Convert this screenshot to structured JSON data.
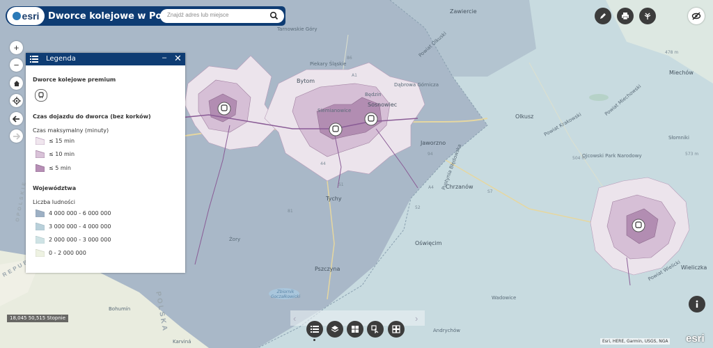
{
  "header": {
    "logo_text": "esri",
    "title": "Dworce kolejowe w Polsce",
    "search_placeholder": "Znajdź adres lub miejsce"
  },
  "toolbar": {
    "icons": [
      "pencil-icon",
      "print-icon",
      "basemap-icon",
      "hide-icon"
    ]
  },
  "map_tools": [
    "zoom-in",
    "zoom-out",
    "home",
    "locate",
    "back",
    "forward"
  ],
  "legend": {
    "title": "Legenda",
    "section_stations": "Dworce kolejowe premium",
    "section_travel": "Czas dojazdu do dworca (bez korków)",
    "travel_subtitle": "Czas maksymalny (minuty)",
    "travel_classes": [
      {
        "label": "≤ 15 min",
        "color": "#f0e6ee"
      },
      {
        "label": "≤ 10 min",
        "color": "#d9c2d8"
      },
      {
        "label": "≤ 5 min",
        "color": "#b78fb6"
      }
    ],
    "section_voivodeships": "Województwa",
    "population_subtitle": "Liczba ludności",
    "population_classes": [
      {
        "label": "4 000 000 - 6 000 000",
        "color": "#9db0c4"
      },
      {
        "label": "3 000 000 - 4 000 000",
        "color": "#b9d0da"
      },
      {
        "label": "2 000 000 - 3 000 000",
        "color": "#cfe3e5"
      },
      {
        "label": "0 - 2 000 000",
        "color": "#eef2e2"
      }
    ]
  },
  "places": [
    "Zawiercie",
    "Tarnowskie Góry",
    "Piekary Śląskie",
    "Bytom",
    "Siemianowice",
    "Sosnowiec",
    "Będzin",
    "Dąbrowa Górnicza",
    "Jaworzno",
    "Chrzanów",
    "Olkusz",
    "Tychy",
    "Żory",
    "Pszczyna",
    "Oświęcim",
    "Wadowice",
    "Andrychów",
    "Bohumín",
    "Karviná",
    "Wieliczka",
    "Miechów",
    "Słomniki",
    "Zbiornik Goczałkowicki",
    "Pustynia Błędowska",
    "Ojcowski Park Narodowy",
    "Powiat Olkuski",
    "Powiat Krakowski",
    "Powiat Miechowski",
    "Powiat Wielicki"
  ],
  "road_numbers": [
    "478 m",
    "A1",
    "A4",
    "S1",
    "S7",
    "94",
    "44",
    "52",
    "81",
    "86",
    "504 m",
    "573 m"
  ],
  "country_labels": [
    "POLSKA",
    "REPUBLIKA",
    "OPOLSKIE"
  ],
  "coordinates": "18,045 50,515 Stopnie",
  "attribution": "Esri, HERE, Garmin, USGS, NGA",
  "bottom_tools": [
    "legend",
    "layers",
    "basemap",
    "measure",
    "gallery"
  ],
  "powered_by": "esri"
}
